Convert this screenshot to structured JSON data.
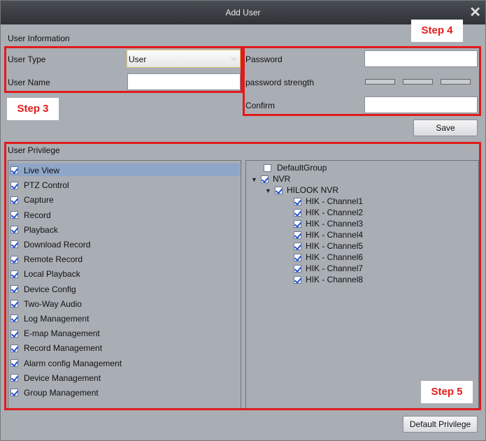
{
  "window": {
    "title": "Add User"
  },
  "user_info": {
    "section_label": "User Information",
    "user_type_label": "User Type",
    "user_type_value": "User",
    "user_name_label": "User Name",
    "user_name_value": "",
    "password_label": "Password",
    "password_value": "",
    "strength_label": "password strength",
    "confirm_label": "Confirm",
    "confirm_value": "",
    "save_label": "Save"
  },
  "privilege": {
    "section_label": "User Privilege",
    "items": [
      {
        "label": "Live View",
        "checked": true,
        "selected": true
      },
      {
        "label": "PTZ Control",
        "checked": true
      },
      {
        "label": "Capture",
        "checked": true
      },
      {
        "label": "Record",
        "checked": true
      },
      {
        "label": "Playback",
        "checked": true
      },
      {
        "label": "Download Record",
        "checked": true
      },
      {
        "label": "Remote Record",
        "checked": true
      },
      {
        "label": "Local Playback",
        "checked": true
      },
      {
        "label": "Device Config",
        "checked": true
      },
      {
        "label": "Two-Way Audio",
        "checked": true
      },
      {
        "label": "Log Management",
        "checked": true
      },
      {
        "label": "E-map Management",
        "checked": true
      },
      {
        "label": "Record Management",
        "checked": true
      },
      {
        "label": "Alarm config Management",
        "checked": true
      },
      {
        "label": "Device Management",
        "checked": true
      },
      {
        "label": "Group Management",
        "checked": true
      }
    ],
    "tree": {
      "default_group": "DefaultGroup",
      "nvr": "NVR",
      "device": "HILOOK NVR",
      "channels": [
        "HIK - Channel1",
        "HIK - Channel2",
        "HIK - Channel3",
        "HIK - Channel4",
        "HIK - Channel5",
        "HIK - Channel6",
        "HIK - Channel7",
        "HIK - Channel8"
      ]
    },
    "default_privilege_label": "Default Privilege"
  },
  "annotations": {
    "step3": "Step 3",
    "step4": "Step 4",
    "step5": "Step 5",
    "color": "#e11b1b"
  }
}
